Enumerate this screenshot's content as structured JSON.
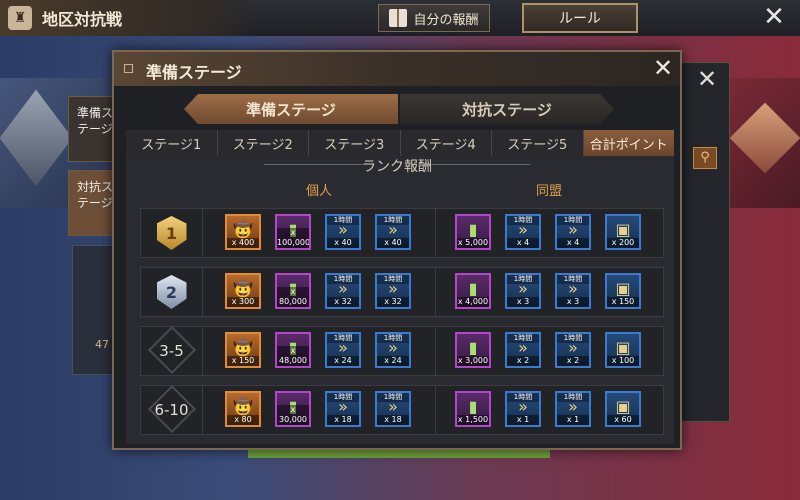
{
  "topbar": {
    "title": "地区対抗戦",
    "my_reward_label": "自分の報酬",
    "rule_label": "ルール"
  },
  "background": {
    "side_tab_1": "準備ステージ",
    "side_tab_2": "対抗ステージ",
    "left_panel_value": "47"
  },
  "modal": {
    "title": "準備ステージ",
    "mode_tabs": [
      {
        "label": "準備ステージ",
        "active": true
      },
      {
        "label": "対抗ステージ",
        "active": false
      }
    ],
    "stage_tabs": [
      {
        "label": "ステージ1",
        "active": false
      },
      {
        "label": "ステージ2",
        "active": false
      },
      {
        "label": "ステージ3",
        "active": false
      },
      {
        "label": "ステージ4",
        "active": false
      },
      {
        "label": "ステージ5",
        "active": false
      },
      {
        "label": "合計ポイント",
        "active": true
      }
    ],
    "section_title": "ランク報酬",
    "individual_label": "個人",
    "alliance_label": "同盟",
    "speedup_tag": "1時間",
    "rows": [
      {
        "rank": "1",
        "badge": "gold",
        "individual": [
          {
            "type": "hero-card",
            "count": "x 400"
          },
          {
            "type": "resource-pack",
            "count": "x 100,000"
          },
          {
            "type": "speedup",
            "count": "x 40"
          },
          {
            "type": "speedup-blue",
            "count": "x 40"
          }
        ],
        "alliance": [
          {
            "type": "resource-pack",
            "count": "x 5,000"
          },
          {
            "type": "speedup",
            "count": "x 4"
          },
          {
            "type": "speedup-blue",
            "count": "x 4"
          },
          {
            "type": "chest",
            "count": "x 200"
          }
        ]
      },
      {
        "rank": "2",
        "badge": "silver",
        "individual": [
          {
            "type": "hero-card",
            "count": "x 300"
          },
          {
            "type": "resource-pack",
            "count": "x 80,000"
          },
          {
            "type": "speedup",
            "count": "x 32"
          },
          {
            "type": "speedup-blue",
            "count": "x 32"
          }
        ],
        "alliance": [
          {
            "type": "resource-pack",
            "count": "x 4,000"
          },
          {
            "type": "speedup",
            "count": "x 3"
          },
          {
            "type": "speedup-blue",
            "count": "x 3"
          },
          {
            "type": "chest",
            "count": "x 150"
          }
        ]
      },
      {
        "rank": "3-5",
        "badge": "none",
        "individual": [
          {
            "type": "hero-card",
            "count": "x 150"
          },
          {
            "type": "resource-pack",
            "count": "x 48,000"
          },
          {
            "type": "speedup",
            "count": "x 24"
          },
          {
            "type": "speedup-blue",
            "count": "x 24"
          }
        ],
        "alliance": [
          {
            "type": "resource-pack",
            "count": "x 3,000"
          },
          {
            "type": "speedup",
            "count": "x 2"
          },
          {
            "type": "speedup-blue",
            "count": "x 2"
          },
          {
            "type": "chest",
            "count": "x 100"
          }
        ]
      },
      {
        "rank": "6-10",
        "badge": "none",
        "individual": [
          {
            "type": "hero-card",
            "count": "x 80"
          },
          {
            "type": "resource-pack",
            "count": "x 30,000"
          },
          {
            "type": "speedup",
            "count": "x 18"
          },
          {
            "type": "speedup-blue",
            "count": "x 18"
          }
        ],
        "alliance": [
          {
            "type": "resource-pack",
            "count": "x 1,500"
          },
          {
            "type": "speedup",
            "count": "x 1"
          },
          {
            "type": "speedup-blue",
            "count": "x 1"
          },
          {
            "type": "chest",
            "count": "x 60"
          }
        ]
      }
    ]
  },
  "colors": {
    "accent": "#e2a24a",
    "tab_active": "#8a5e3e",
    "item_orange": "#e08a3a",
    "item_purple": "#b048c8",
    "item_blue": "#3a7ad0"
  }
}
